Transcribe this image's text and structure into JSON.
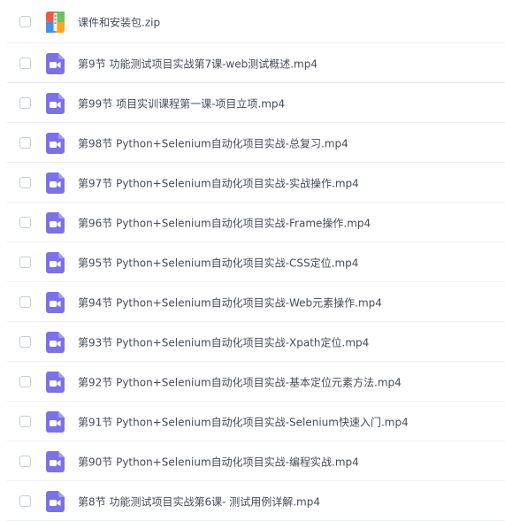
{
  "files": [
    {
      "name": "课件和安装包.zip",
      "icon": "zip-archive-icon"
    },
    {
      "name": "第9节 功能测试项目实战第7课-web测试概述.mp4",
      "icon": "video-file-icon"
    },
    {
      "name": "第99节 项目实训课程第一课-项目立项.mp4",
      "icon": "video-file-icon"
    },
    {
      "name": "第98节 Python+Selenium自动化项目实战-总复习.mp4",
      "icon": "video-file-icon"
    },
    {
      "name": "第97节 Python+Selenium自动化项目实战-实战操作.mp4",
      "icon": "video-file-icon"
    },
    {
      "name": "第96节 Python+Selenium自动化项目实战-Frame操作.mp4",
      "icon": "video-file-icon"
    },
    {
      "name": "第95节 Python+Selenium自动化项目实战-CSS定位.mp4",
      "icon": "video-file-icon"
    },
    {
      "name": "第94节 Python+Selenium自动化项目实战-Web元素操作.mp4",
      "icon": "video-file-icon"
    },
    {
      "name": "第93节 Python+Selenium自动化项目实战-Xpath定位.mp4",
      "icon": "video-file-icon"
    },
    {
      "name": "第92节 Python+Selenium自动化项目实战-基本定位元素方法.mp4",
      "icon": "video-file-icon"
    },
    {
      "name": "第91节 Python+Selenium自动化项目实战-Selenium快速入门.mp4",
      "icon": "video-file-icon"
    },
    {
      "name": "第90节 Python+Selenium自动化项目实战-编程实战.mp4",
      "icon": "video-file-icon"
    },
    {
      "name": "第8节 功能测试项目实战第6课- 测试用例详解.mp4",
      "icon": "video-file-icon"
    }
  ],
  "colors": {
    "video_icon": "#7b72e6",
    "zip_orange": "#f5a623",
    "zip_red": "#e95a4d",
    "zip_green": "#6cc164",
    "zip_blue": "#4a90e2",
    "text": "#454d5a",
    "divider": "#eef0f3"
  }
}
